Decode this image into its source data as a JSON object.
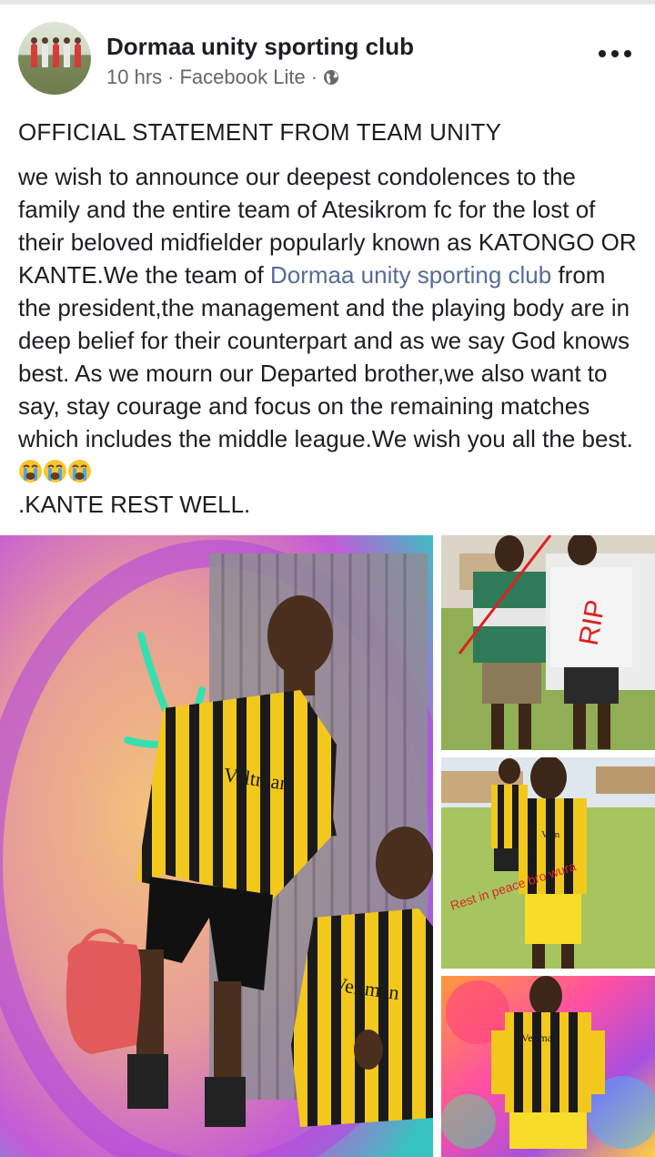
{
  "post": {
    "author": "Dormaa unity sporting club",
    "time": "10 hrs",
    "separator": "·",
    "source": "Facebook Lite",
    "visibility_icon": "globe-icon",
    "more_icon": "more-options-icon",
    "title": "OFFICIAL STATEMENT FROM TEAM UNITY",
    "body_part1": "we wish to announce our deepest condolences to the family and the entire team of Atesikrom fc for the lost of their beloved midfielder popularly known as KATONGO OR KANTE.We the team of ",
    "body_link": "Dormaa unity sporting club",
    "body_part2": " from the president,the management and the playing body are in deep belief for their counterpart and as we say God knows best. As we mourn our Departed brother,we also want to say, stay courage and focus on the remaining matches which includes the middle league.We wish you all the best.",
    "body_emojis": [
      "crying-face-emoji",
      "crying-face-emoji",
      "crying-face-emoji"
    ],
    "body_end": ".KANTE REST WELL."
  },
  "photos": {
    "main": {
      "jersey_text_1": "Veltman",
      "jersey_text_2": "Veltman"
    },
    "top_right": {
      "overlay_text": "RIP"
    },
    "middle_right": {
      "jersey_text": "Veln",
      "caption": "Rest in peace bro wura"
    },
    "bottom_right": {
      "jersey_text": "Veltman"
    }
  },
  "colors": {
    "link": "#576b95",
    "meta": "#65676b",
    "jersey_yellow": "#f2c81d",
    "jersey_black": "#1a1a1a"
  }
}
